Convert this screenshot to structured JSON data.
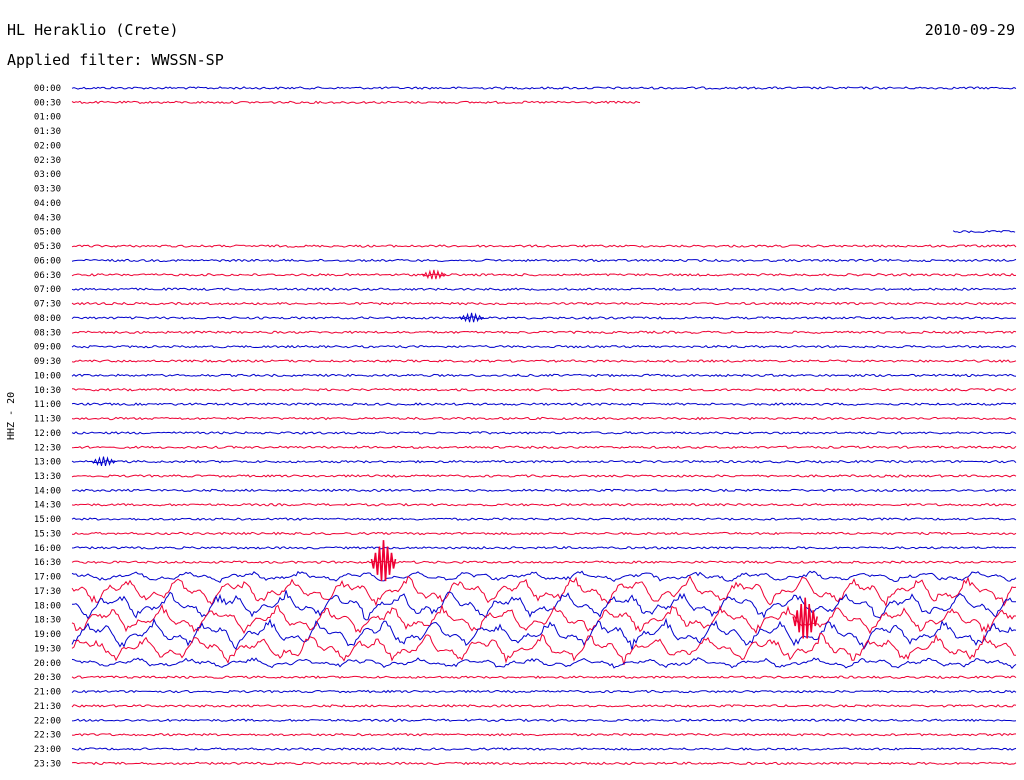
{
  "header": {
    "station": "HL Heraklio (Crete)",
    "date": "2010-09-29",
    "filter": "Applied filter: WWSSN-SP"
  },
  "channel_label": "HHZ - 20",
  "colors": {
    "even_trace": "#0000cc",
    "odd_trace": "#ee0033"
  },
  "chart_data": {
    "type": "line",
    "title": "HL Heraklio (Crete)",
    "subtitle": "Applied filter: WWSSN-SP",
    "date": "2010-09-29",
    "ylabel": "HHZ - 20",
    "y_ticks": [
      "00:00",
      "00:30",
      "01:00",
      "01:30",
      "02:00",
      "02:30",
      "03:00",
      "03:30",
      "04:00",
      "04:30",
      "05:00",
      "05:30",
      "06:00",
      "06:30",
      "07:00",
      "07:30",
      "08:00",
      "08:30",
      "09:00",
      "09:30",
      "10:00",
      "10:30",
      "11:00",
      "11:30",
      "12:00",
      "12:30",
      "13:00",
      "13:30",
      "14:00",
      "14:30",
      "15:00",
      "15:30",
      "16:00",
      "16:30",
      "17:00",
      "17:30",
      "18:00",
      "18:30",
      "19:00",
      "19:30",
      "20:00",
      "20:30",
      "21:00",
      "21:30",
      "22:00",
      "22:30",
      "23:00",
      "23:30"
    ],
    "x_unit": "minutes into 30-minute row",
    "xlim": [
      0,
      30
    ],
    "data_coverage": [
      {
        "row": "00:00",
        "start_min": 0,
        "end_min": 30
      },
      {
        "row": "00:30",
        "start_min": 0,
        "end_min": 18.1
      },
      {
        "row": "05:00",
        "start_min": 28.0,
        "end_min": 30
      },
      {
        "row": "05:30-23:30",
        "start_min": 0,
        "end_min": 30
      }
    ],
    "notable_events": [
      {
        "row": "06:30",
        "minute": 11.5,
        "description": "small spike"
      },
      {
        "row": "08:00",
        "minute": 12.7,
        "description": "small spike"
      },
      {
        "row": "13:00",
        "minute": 1.0,
        "description": "small spike"
      },
      {
        "row": "16:30",
        "minute": 9.9,
        "description": "large spike"
      },
      {
        "row": "17:00-20:00",
        "minute": 0,
        "description": "large-amplitude waveforms across all traces"
      },
      {
        "row": "18:30",
        "minute": 23.3,
        "description": "high-amplitude burst"
      }
    ],
    "grid": false
  }
}
